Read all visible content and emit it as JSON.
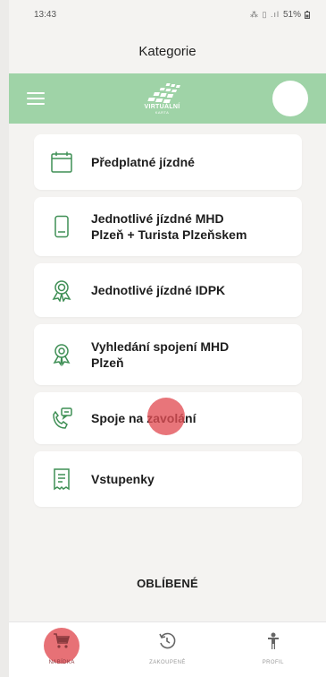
{
  "status_bar": {
    "time": "13:43",
    "icons": "⁂ ▯ .ıl",
    "battery": "51%"
  },
  "page_title": "Kategorie",
  "header": {
    "logo_text": "VIRTUÁLNÍ",
    "logo_sub": "KARTA"
  },
  "menu_items": [
    {
      "label": "Předplatné jízdné",
      "icon": "calendar-icon"
    },
    {
      "label": "Jednotlivé jízdné MHD\nPlzeň + Turista Plzeňskem",
      "icon": "ticket-card-icon"
    },
    {
      "label": "Jednotlivé jízdné IDPK",
      "icon": "badge-icon"
    },
    {
      "label": "Vyhledání spojení MHD\nPlzeň",
      "icon": "route-search-icon"
    },
    {
      "label": "Spoje na zavolání",
      "icon": "phone-chat-icon"
    },
    {
      "label": "Vstupenky",
      "icon": "receipt-icon"
    }
  ],
  "favorites_heading": "OBLÍBENÉ",
  "bottom_nav": [
    {
      "label": "NABÍDKA",
      "icon": "cart-icon",
      "active": true
    },
    {
      "label": "ZAKOUPENÉ",
      "icon": "history-icon",
      "active": false
    },
    {
      "label": "PROFIL",
      "icon": "person-icon",
      "active": false
    }
  ],
  "colors": {
    "header_green": "#9fd3a7",
    "icon_green": "#3f8f55",
    "tap_red": "#e14e54",
    "background": "#f4f3f1"
  }
}
